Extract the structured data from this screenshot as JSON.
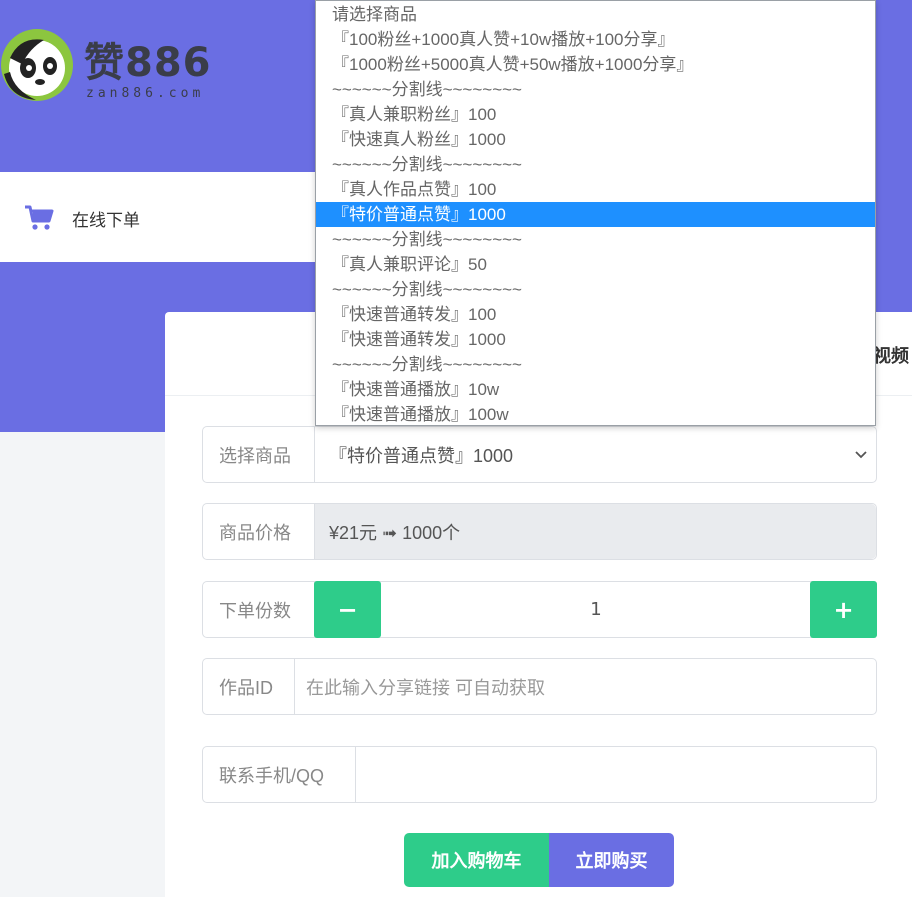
{
  "brand": {
    "name": "赞886",
    "domain": "zan886.com"
  },
  "nav": {
    "order_label": "在线下单"
  },
  "panel": {
    "header_partial": "短视频"
  },
  "form": {
    "product_label": "选择商品",
    "product_value": "『特价普通点赞』1000",
    "price_label": "商品价格",
    "price_value": "¥21元 ➟ 1000个",
    "qty_label": "下单份数",
    "qty_minus": "−",
    "qty_value": "1",
    "qty_plus": "+",
    "work_id_label": "作品ID",
    "work_id_placeholder": "在此输入分享链接 可自动获取",
    "contact_label": "联系手机/QQ",
    "contact_value": ""
  },
  "actions": {
    "add_to_cart": "加入购物车",
    "buy_now": "立即购买"
  },
  "dropdown": {
    "selected_index": 8,
    "options": [
      "请选择商品",
      "『100粉丝+1000真人赞+10w播放+100分享』",
      "『1000粉丝+5000真人赞+50w播放+1000分享』",
      "~~~~~~分割线~~~~~~~~",
      "『真人兼职粉丝』100",
      "『快速真人粉丝』1000",
      "~~~~~~分割线~~~~~~~~",
      "『真人作品点赞』100",
      "『特价普通点赞』1000",
      "~~~~~~分割线~~~~~~~~",
      "『真人兼职评论』50",
      "~~~~~~分割线~~~~~~~~",
      "『快速普通转发』100",
      "『快速普通转发』1000",
      "~~~~~~分割线~~~~~~~~",
      "『快速普通播放』10w",
      "『快速普通播放』100w"
    ]
  },
  "colors": {
    "hero_bg": "#6a6ee3",
    "accent_green": "#2ecc8a",
    "selected_option": "#1e90ff"
  }
}
